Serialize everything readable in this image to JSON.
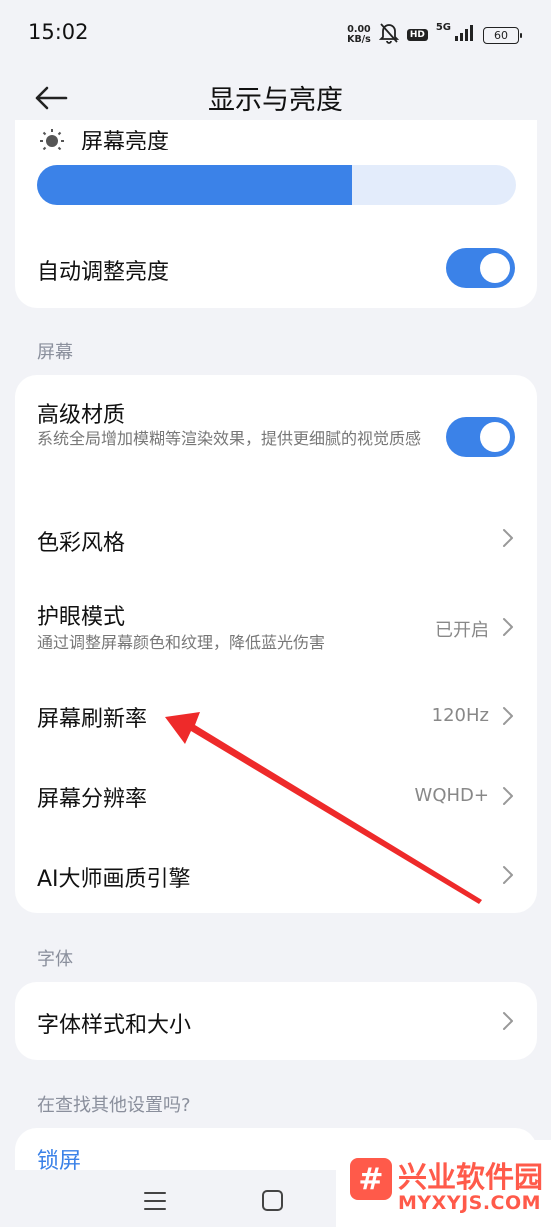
{
  "status_bar": {
    "time": "15:02",
    "net_speed_value": "0.00",
    "net_speed_unit": "KB/s",
    "hd": "HD",
    "network": "5G",
    "battery": "60"
  },
  "header": {
    "title": "显示与亮度",
    "back_icon": "back-arrow-icon"
  },
  "brightness": {
    "label": "屏幕亮度",
    "level_fraction": 0.657,
    "auto_label": "自动调整亮度",
    "auto_on": true
  },
  "sections": {
    "screen": "屏幕",
    "font": "字体",
    "other": "在查找其他设置吗?"
  },
  "screen_items": {
    "material_title": "高级材质",
    "material_desc": "系统全局增加模糊等渲染效果，提供更细腻的视觉质感",
    "material_on": true,
    "color_style": "色彩风格",
    "eye_care_title": "护眼模式",
    "eye_care_desc": "通过调整屏幕颜色和纹理，降低蓝光伤害",
    "eye_care_value": "已开启",
    "refresh_title": "屏幕刷新率",
    "refresh_value": "120Hz",
    "resolution_title": "屏幕分辨率",
    "resolution_value": "WQHD+",
    "ai_engine": "AI大师画质引擎"
  },
  "font_items": {
    "style_size": "字体样式和大小"
  },
  "other_items": {
    "lock_screen": "锁屏"
  },
  "watermark": {
    "logo_glyph": "#",
    "name": "兴业软件园",
    "url": "MYXYJS.COM"
  },
  "colors": {
    "accent": "#3b82e8",
    "annotation": "#ee2a2a",
    "background": "#f2f3f7"
  }
}
